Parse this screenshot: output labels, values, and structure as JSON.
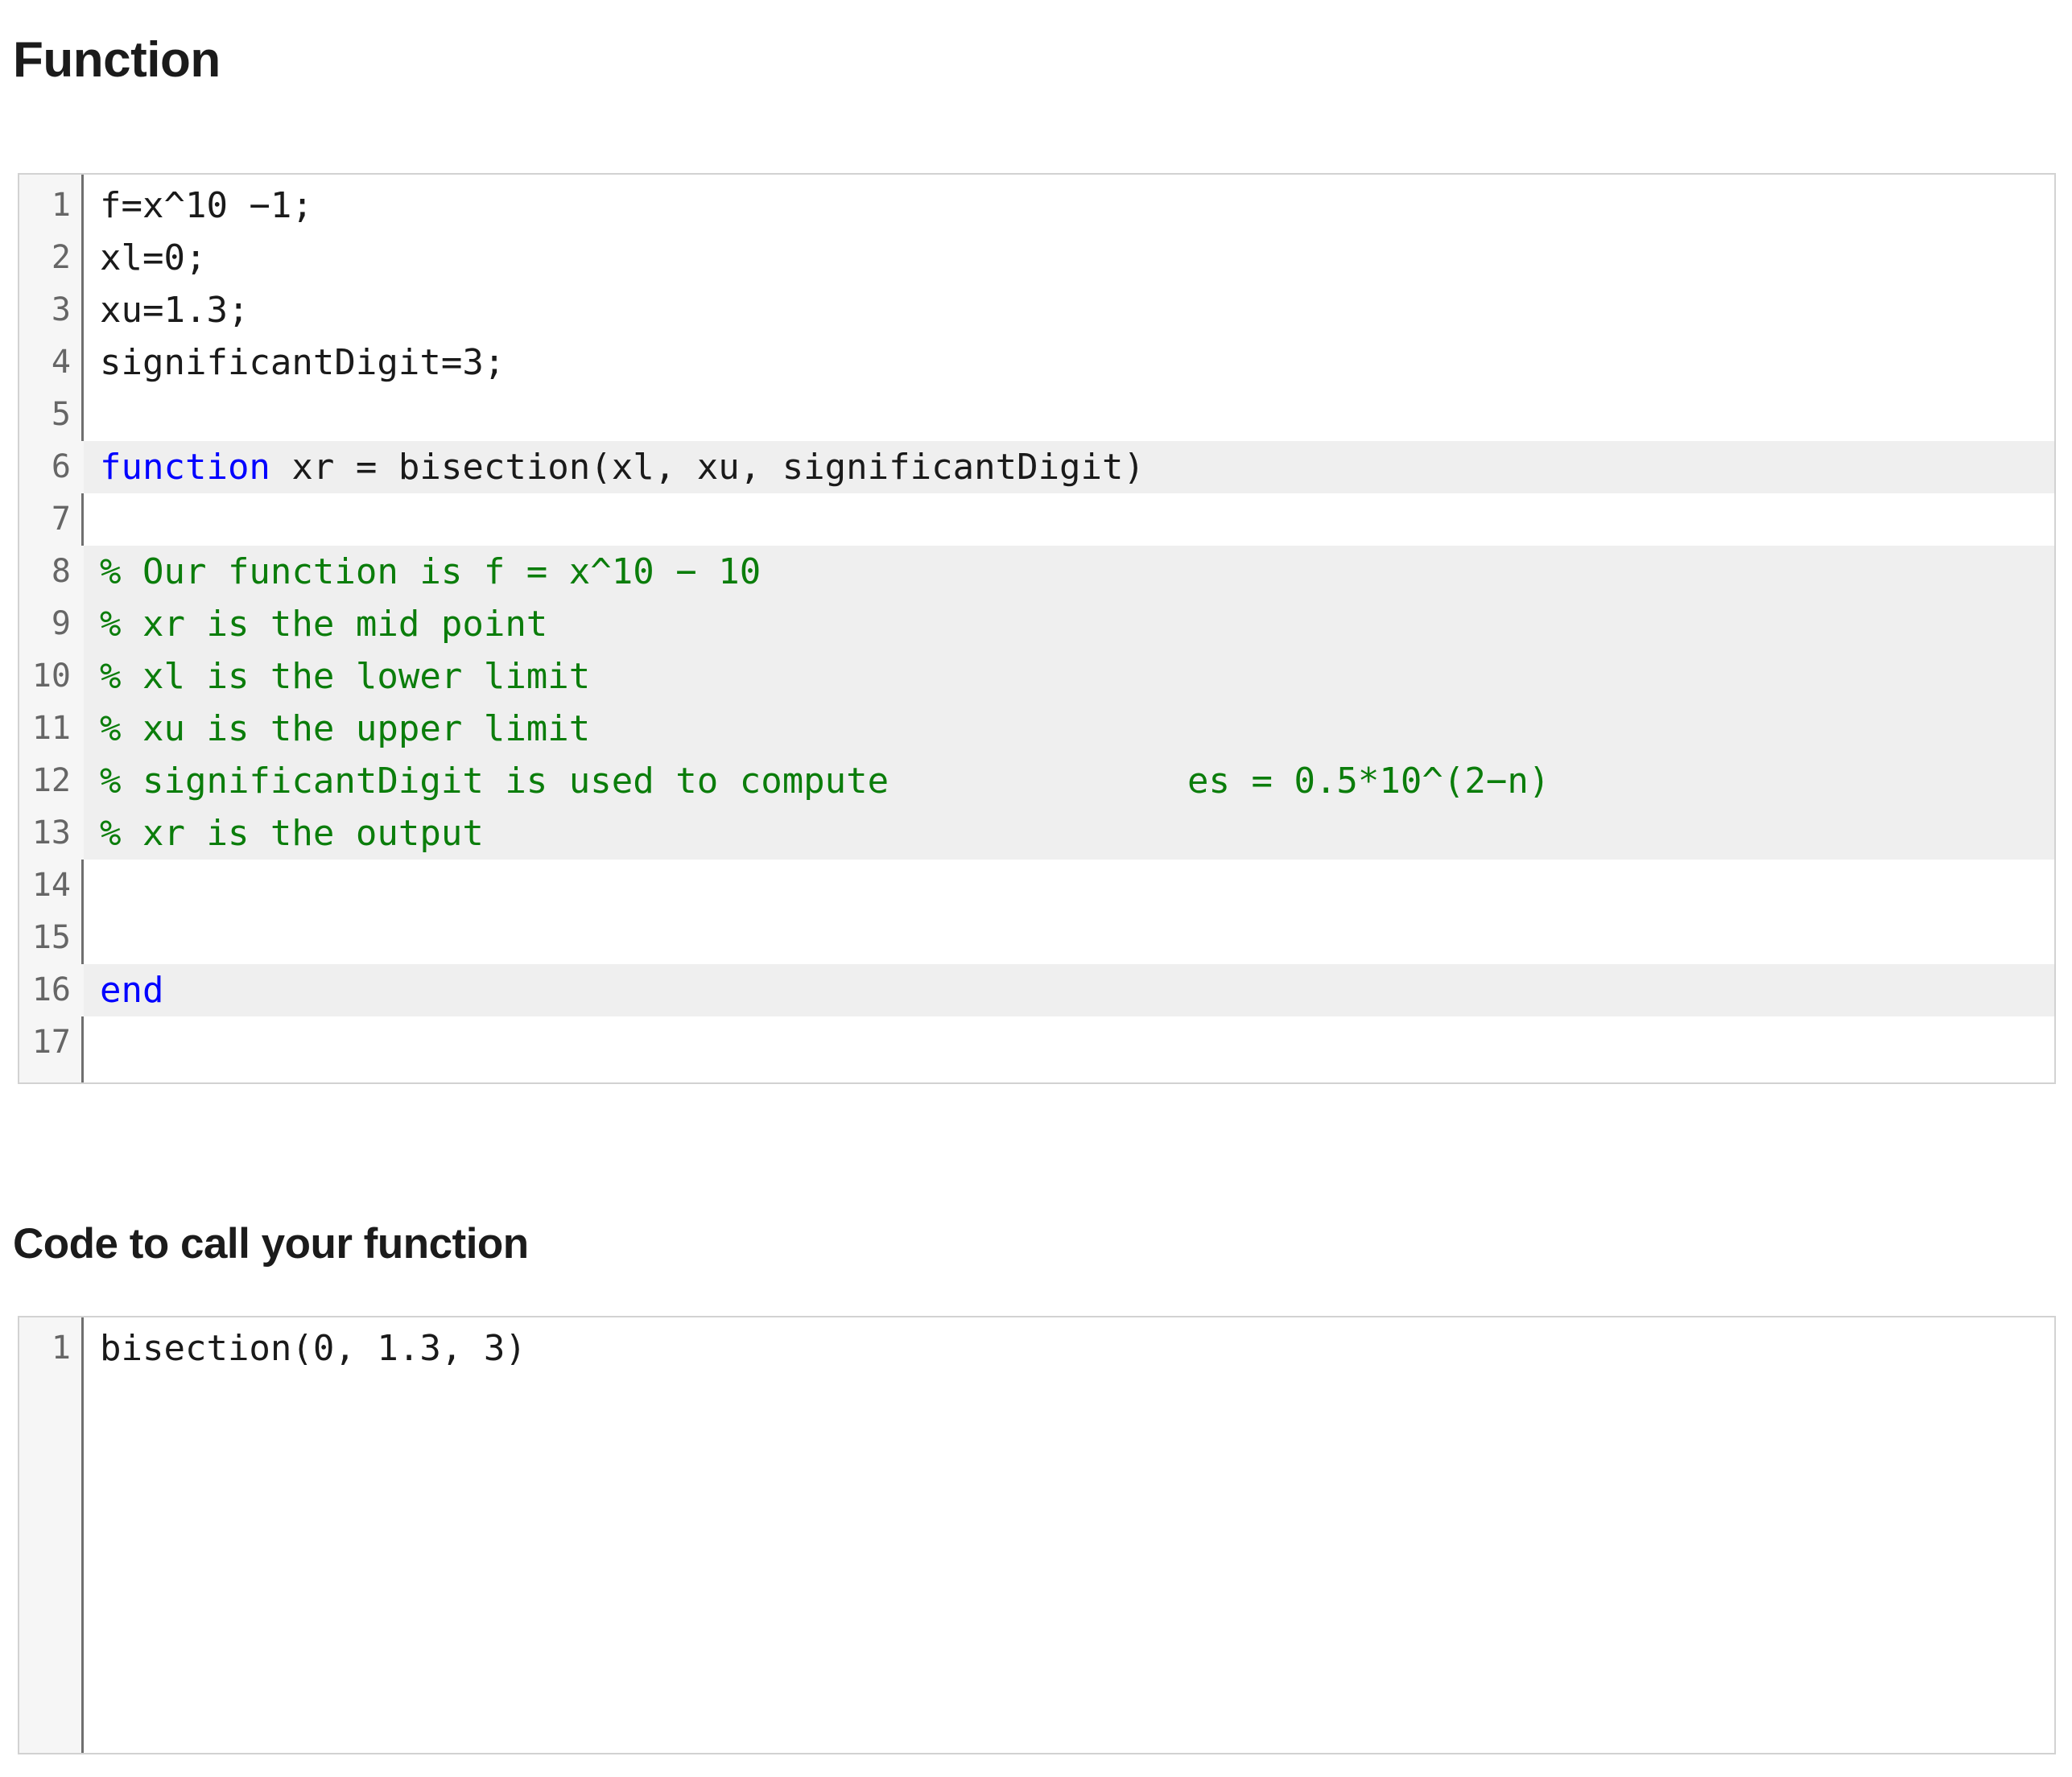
{
  "headings": {
    "function": "Function",
    "code_to_call": "Code to call your function"
  },
  "function_block": {
    "lines": [
      {
        "num": "1",
        "highlight": false,
        "type": "plain",
        "text": "f=x^10 −1;"
      },
      {
        "num": "2",
        "highlight": false,
        "type": "plain",
        "text": "xl=0;"
      },
      {
        "num": "3",
        "highlight": false,
        "type": "plain",
        "text": "xu=1.3;"
      },
      {
        "num": "4",
        "highlight": false,
        "type": "plain",
        "text": "significantDigit=3;"
      },
      {
        "num": "5",
        "highlight": false,
        "type": "plain",
        "text": ""
      },
      {
        "num": "6",
        "highlight": true,
        "type": "keyword",
        "keyword": "function",
        "rest": " xr = bisection(xl, xu, significantDigit)",
        "text": "function xr = bisection(xl, xu, significantDigit)"
      },
      {
        "num": "7",
        "highlight": false,
        "type": "plain",
        "text": ""
      },
      {
        "num": "8",
        "highlight": true,
        "type": "comment",
        "text": "% Our function is f = x^10 − 10"
      },
      {
        "num": "9",
        "highlight": true,
        "type": "comment",
        "text": "% xr is the mid point"
      },
      {
        "num": "10",
        "highlight": true,
        "type": "comment",
        "text": "% xl is the lower limit"
      },
      {
        "num": "11",
        "highlight": true,
        "type": "comment",
        "text": "% xu is the upper limit"
      },
      {
        "num": "12",
        "highlight": true,
        "type": "comment",
        "text": "% significantDigit is used to compute              es = 0.5*10^(2−n)"
      },
      {
        "num": "13",
        "highlight": true,
        "type": "comment",
        "text": "% xr is the output"
      },
      {
        "num": "14",
        "highlight": false,
        "type": "plain",
        "text": ""
      },
      {
        "num": "15",
        "highlight": false,
        "type": "plain",
        "text": ""
      },
      {
        "num": "16",
        "highlight": true,
        "type": "keyword",
        "keyword": "end",
        "rest": "",
        "text": "end"
      },
      {
        "num": "17",
        "highlight": false,
        "type": "plain",
        "text": ""
      }
    ]
  },
  "call_block": {
    "lines": [
      {
        "num": "1",
        "highlight": false,
        "type": "plain",
        "text": "bisection(0, 1.3, 3)"
      }
    ]
  },
  "colors": {
    "keyword": "#0000ff",
    "comment": "#0b7d0b",
    "plain": "#1a1a1a",
    "gutter_bg": "#f6f6f6",
    "highlight_bg": "#efefef",
    "border": "#d2d2d2",
    "heading": "#1b1b1b"
  }
}
